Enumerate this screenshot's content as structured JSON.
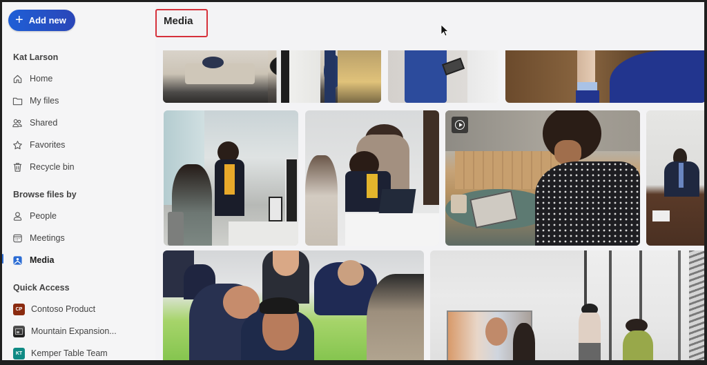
{
  "sidebar": {
    "add_new_label": "Add new",
    "user_name": "Kat Larson",
    "nav_items": [
      {
        "label": "Home",
        "icon": "home-icon"
      },
      {
        "label": "My files",
        "icon": "folder-icon"
      },
      {
        "label": "Shared",
        "icon": "people-icon"
      },
      {
        "label": "Favorites",
        "icon": "star-icon"
      },
      {
        "label": "Recycle bin",
        "icon": "trash-icon"
      }
    ],
    "browse_title": "Browse files by",
    "browse_items": [
      {
        "label": "People",
        "icon": "person-icon"
      },
      {
        "label": "Meetings",
        "icon": "calendar-icon"
      },
      {
        "label": "Media",
        "icon": "image-icon",
        "active": true
      }
    ],
    "quick_access_title": "Quick Access",
    "quick_access": [
      {
        "label": "Contoso Product",
        "badge": "CP",
        "color": "#8a2a0f"
      },
      {
        "label": "Mountain Expansion...",
        "badge": "",
        "color": "#2b2b2b"
      },
      {
        "label": "Kemper Table Team",
        "badge": "KT",
        "color": "#0f8a84"
      }
    ]
  },
  "main": {
    "title": "Media",
    "tiles": [
      {
        "name": "living-room-photo",
        "desc": "Living room with people standing"
      },
      {
        "name": "tablet-user-photo",
        "desc": "Person in blue sweater holding tablet"
      },
      {
        "name": "blue-suit-photo",
        "desc": "Close-up of person in blue suit"
      },
      {
        "name": "office-meeting-photo",
        "desc": "Woman in yellow top talking at desk"
      },
      {
        "name": "laptop-collaboration-photo",
        "desc": "Two women looking at laptop"
      },
      {
        "name": "tablet-pen-video",
        "desc": "Woman using pen on tablet",
        "video": true
      },
      {
        "name": "businessman-photo",
        "desc": "Man in suit at conference table"
      },
      {
        "name": "classroom-photo",
        "desc": "Students in classroom"
      },
      {
        "name": "video-conference-photo",
        "desc": "Meeting room with video call on screen"
      }
    ]
  },
  "colors": {
    "accent": "#2b6cd4",
    "highlight_box": "#d6303a"
  }
}
